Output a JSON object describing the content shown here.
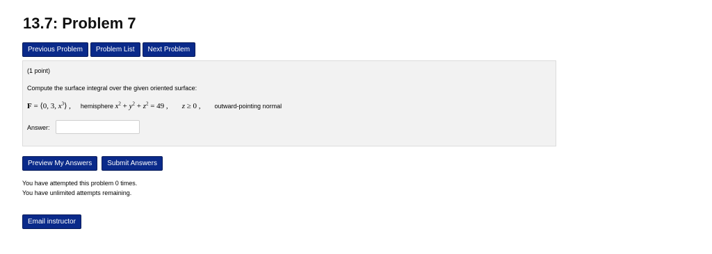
{
  "page": {
    "title": "13.7: Problem 7"
  },
  "nav": {
    "previous": "Previous Problem",
    "list": "Problem List",
    "next": "Next Problem"
  },
  "problem": {
    "points": "(1 point)",
    "prompt": "Compute the surface integral over the given oriented surface:",
    "field_label": "F",
    "field_value": "⟨0, 3, x³⟩",
    "surface_text": "hemisphere",
    "surface_eq": "x² + y² + z² = 49,",
    "condition": "z ≥ 0,",
    "orientation": "outward-pointing normal",
    "answer_label": "Answer:",
    "answer_value": ""
  },
  "actions": {
    "preview": "Preview My Answers",
    "submit": "Submit Answers"
  },
  "status": {
    "attempts": "You have attempted this problem 0 times.",
    "remaining": "You have unlimited attempts remaining."
  },
  "footer": {
    "email": "Email instructor"
  },
  "colors": {
    "button_bg": "#0a2a8a",
    "problem_bg": "#f2f2f2"
  }
}
